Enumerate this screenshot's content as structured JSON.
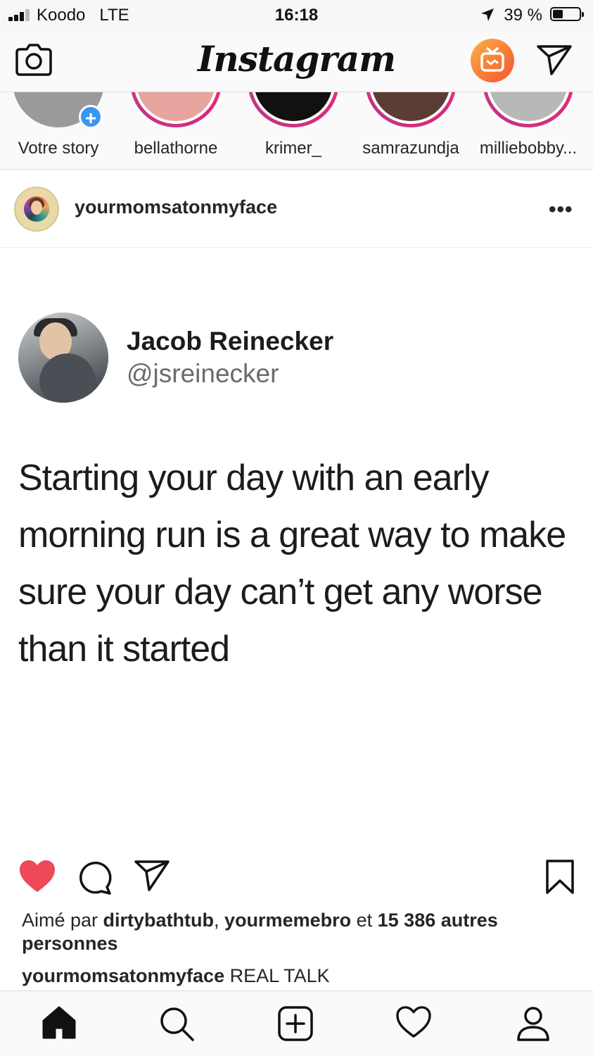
{
  "status_bar": {
    "carrier": "Koodo",
    "network": "LTE",
    "time": "16:18",
    "battery_percent": "39 %",
    "battery_level": 0.39
  },
  "header": {
    "logo_text": "Instagram",
    "icons": [
      "camera-icon",
      "igtv-icon",
      "direct-send-icon"
    ],
    "igtv_color": "#f56b2f"
  },
  "stories": [
    {
      "name": "Votre story",
      "has_ring": false,
      "own": true,
      "pic_color": "#9a9a9a"
    },
    {
      "name": "bellathorne",
      "has_ring": true,
      "pic_color": "#e8a5a0"
    },
    {
      "name": "krimer_",
      "has_ring": true,
      "pic_color": "#111111"
    },
    {
      "name": "samrazundja",
      "has_ring": true,
      "pic_color": "#5a3e36"
    },
    {
      "name": "milliebobby...",
      "has_ring": true,
      "pic_color": "#b8b8b8"
    }
  ],
  "post": {
    "username": "yourmomsatonmyface",
    "more_label": "•••",
    "tweet": {
      "name": "Jacob Reinecker",
      "handle": "@jsreinecker",
      "text": "Starting your day with an early morning run is a great way to make sure your day can’t get any worse than it started"
    },
    "liked": true,
    "like_color": "#ed4956",
    "likes": {
      "prefix": "Aimé par ",
      "user1": "dirtybathtub",
      "sep": ", ",
      "user2": "yourmemebro",
      "and": " et ",
      "others": "15 386 autres personnes"
    },
    "caption": {
      "user": "yourmomsatonmyface",
      "text": " REAL TALK"
    }
  },
  "tabbar": {
    "tabs": [
      "home-icon",
      "search-icon",
      "new-post-icon",
      "activity-icon",
      "profile-icon"
    ]
  }
}
